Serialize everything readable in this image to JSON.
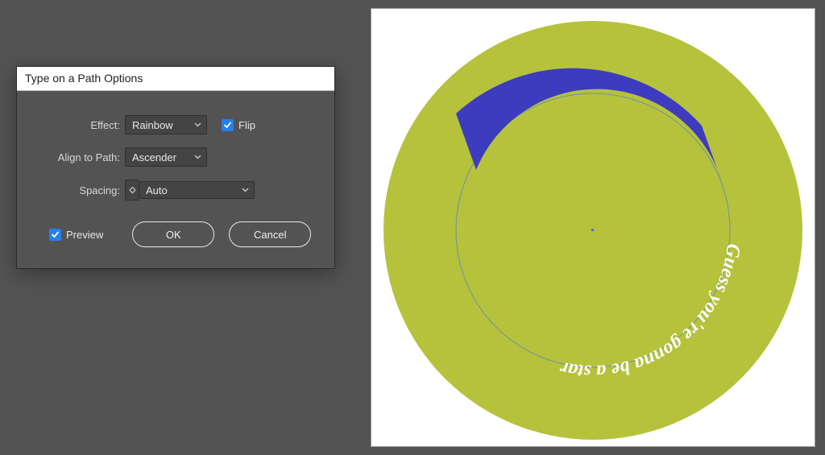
{
  "dialog": {
    "title": "Type on a Path Options",
    "effect_label": "Effect:",
    "effect_value": "Rainbow",
    "flip_label": "Flip",
    "flip_checked": true,
    "align_label": "Align to Path:",
    "align_value": "Ascender",
    "spacing_label": "Spacing:",
    "spacing_value": "Auto",
    "preview_label": "Preview",
    "preview_checked": true,
    "ok_label": "OK",
    "cancel_label": "Cancel"
  },
  "artwork": {
    "outer_fill": "#b6c23c",
    "inner_stroke": "#6f8fa7",
    "band_fill": "#3d3cbf",
    "text_value": "Guess you're gonna be a star",
    "text_fontsize": "24"
  }
}
